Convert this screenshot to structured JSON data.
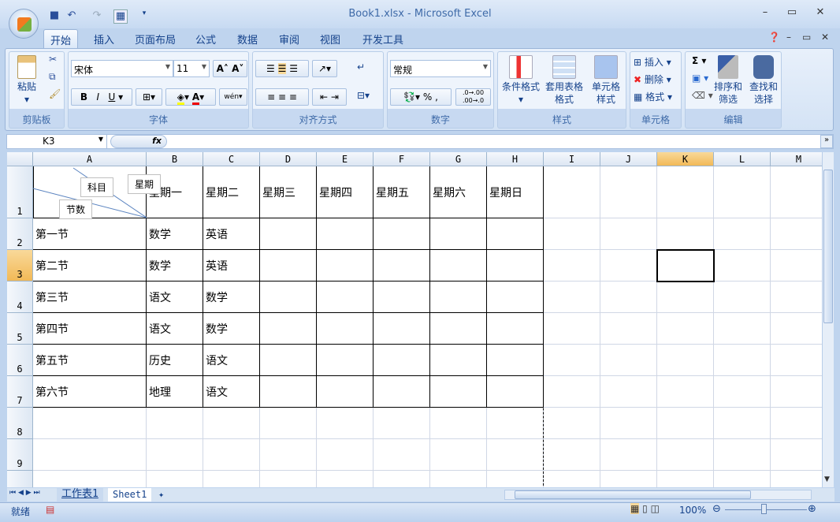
{
  "window": {
    "title": "Book1.xlsx - Microsoft Excel"
  },
  "tabs": [
    "开始",
    "插入",
    "页面布局",
    "公式",
    "数据",
    "审阅",
    "视图",
    "开发工具"
  ],
  "ribbon": {
    "clipboard": {
      "label": "剪贴板",
      "paste": "粘贴"
    },
    "font": {
      "label": "字体",
      "name": "宋体",
      "size": "11",
      "bold": "B",
      "italic": "I",
      "underline": "U",
      "color_a": "A",
      "phonetic": "wén"
    },
    "alignment": {
      "label": "对齐方式"
    },
    "number": {
      "label": "数字",
      "format": "常规",
      "percent": "%",
      "comma": ",",
      "inc": ".0→.00",
      "dec": ".00→.0"
    },
    "styles": {
      "label": "样式",
      "conditional": "条件格式",
      "table": "套用表格格式",
      "cell": "单元格样式"
    },
    "cells": {
      "label": "单元格",
      "insert": "插入",
      "delete": "删除",
      "format": "格式"
    },
    "editing": {
      "label": "编辑",
      "sum": "Σ",
      "sort": "排序和筛选",
      "find": "查找和选择"
    }
  },
  "formula_bar": {
    "name_box": "K3",
    "fx": "fx",
    "value": ""
  },
  "columns": [
    "A",
    "B",
    "C",
    "D",
    "E",
    "F",
    "G",
    "H",
    "I",
    "J",
    "K",
    "L",
    "M"
  ],
  "rows": [
    "1",
    "2",
    "3",
    "4",
    "5",
    "6",
    "7",
    "8",
    "9"
  ],
  "header_cell": {
    "subject": "科目",
    "week": "星期",
    "period": "节数"
  },
  "table": [
    [
      "",
      "星期一",
      "星期二",
      "星期三",
      "星期四",
      "星期五",
      "星期六",
      "星期日"
    ],
    [
      "第一节",
      "数学",
      "英语",
      "",
      "",
      "",
      "",
      ""
    ],
    [
      "第二节",
      "数学",
      "英语",
      "",
      "",
      "",
      "",
      ""
    ],
    [
      "第三节",
      "语文",
      "数学",
      "",
      "",
      "",
      "",
      ""
    ],
    [
      "第四节",
      "语文",
      "数学",
      "",
      "",
      "",
      "",
      ""
    ],
    [
      "第五节",
      "历史",
      "语文",
      "",
      "",
      "",
      "",
      ""
    ],
    [
      "第六节",
      "地理",
      "语文",
      "",
      "",
      "",
      "",
      ""
    ]
  ],
  "selected_cell": "K3",
  "sheets": [
    "工作表1",
    "Sheet1"
  ],
  "status": {
    "ready": "就绪",
    "zoom": "100%"
  }
}
